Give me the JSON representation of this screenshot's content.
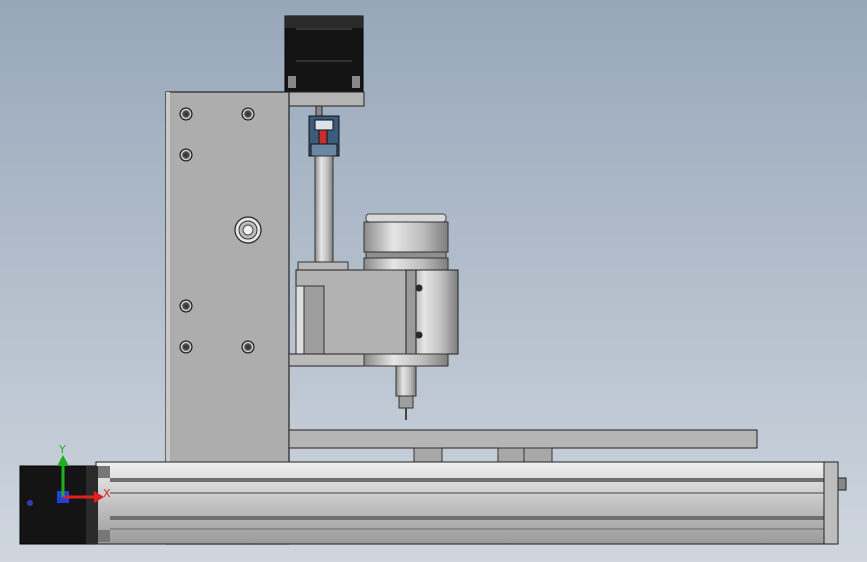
{
  "viewport": {
    "background_top": "#97A7BA",
    "background_bottom": "#CFD6DE"
  },
  "triad": {
    "y_label": "Y",
    "x_label": "X",
    "x_color": "#E02020",
    "y_color": "#20B020",
    "z_color": "#2040E0"
  },
  "colors": {
    "plate": "#AEAEAE",
    "plate_dark": "#8F8F8F",
    "motor": "#141414",
    "rail": "#C8C8C8",
    "rail_dark": "#6F6F6F",
    "spindle": "#BDBDBD",
    "coupler_blue": "#3C5A7A",
    "coupler_red": "#C83030"
  }
}
